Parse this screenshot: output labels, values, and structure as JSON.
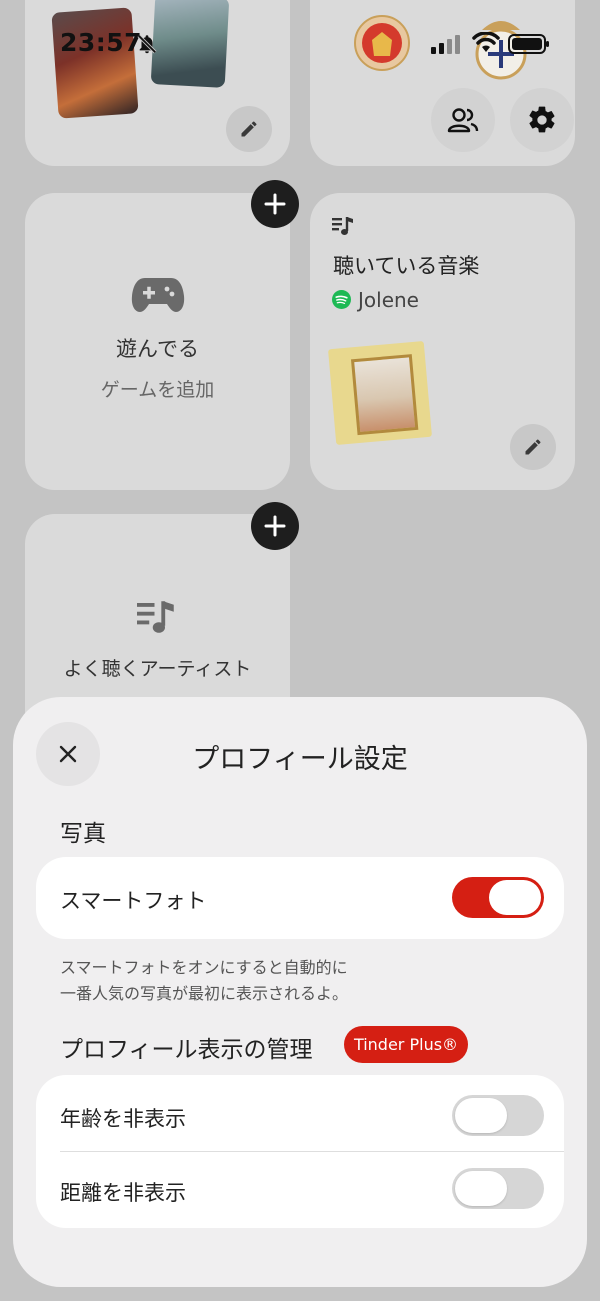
{
  "status_bar": {
    "time": "23:57"
  },
  "cards": {
    "games": {
      "title": "遊んでる",
      "subtitle": "ゲームを追加"
    },
    "listening": {
      "title": "聴いている音楽",
      "track": "Jolene"
    },
    "top_artists": {
      "title": "よく聴くアーティスト"
    }
  },
  "sheet": {
    "title": "プロフィール設定",
    "photo_section": {
      "heading": "写真",
      "smart_photo_label": "スマートフォト",
      "smart_photo_on": true,
      "helper_line1": "スマートフォトをオンにすると自動的に",
      "helper_line2": "一番人気の写真が最初に表示されるよ。"
    },
    "visibility_section": {
      "heading": "プロフィール表示の管理",
      "badge": "Tinder Plus®",
      "hide_age_label": "年齢を非表示",
      "hide_age_on": false,
      "hide_distance_label": "距離を非表示",
      "hide_distance_on": false
    }
  },
  "colors": {
    "accent": "#d51f13",
    "spotify": "#1db954"
  },
  "icons": [
    "pencil-icon",
    "people-icon",
    "gear-icon",
    "plus-icon",
    "gamepad-icon",
    "music-note-icon",
    "spotify-icon",
    "close-icon",
    "bell-off-icon",
    "signal-icon",
    "wifi-icon",
    "battery-icon"
  ]
}
